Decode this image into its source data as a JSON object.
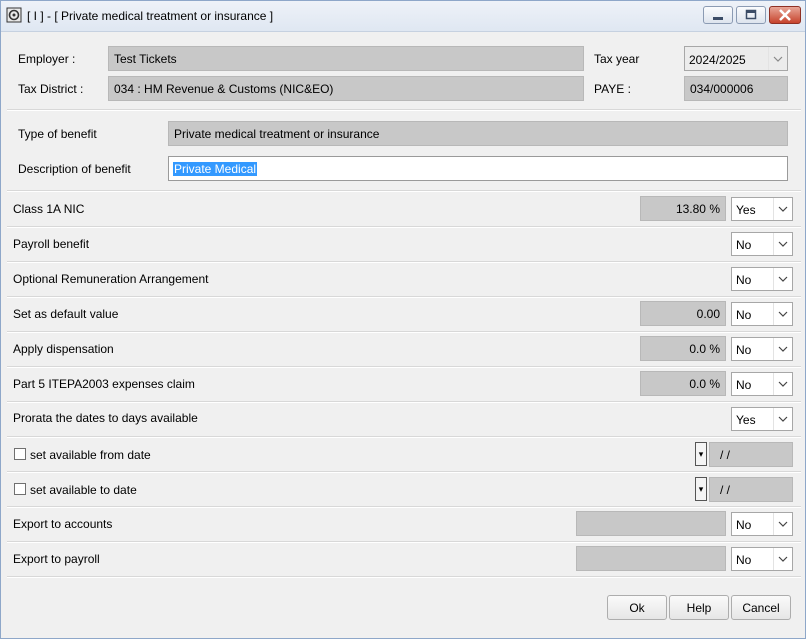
{
  "window": {
    "title": "[ I ] - [ Private medical treatment or insurance ]"
  },
  "header": {
    "employer_label": "Employer :",
    "employer_value": "Test Tickets",
    "tax_district_label": "Tax District :",
    "tax_district_value": "034 : HM Revenue & Customs (NIC&EO)",
    "tax_year_label": "Tax year",
    "tax_year_value": "2024/2025",
    "paye_label": "PAYE :",
    "paye_value": "034/000006"
  },
  "benefit": {
    "type_label": "Type of benefit",
    "type_value": "Private medical treatment or insurance",
    "desc_label": "Description of benefit",
    "desc_value": "Private Medical"
  },
  "rows": {
    "class1a": {
      "label": "Class 1A NIC",
      "value": "13.80 %",
      "select": "Yes"
    },
    "payroll": {
      "label": "Payroll benefit",
      "select": "No"
    },
    "ora": {
      "label": "Optional Remuneration Arrangement",
      "select": "No"
    },
    "default_value": {
      "label": "Set as default value",
      "value": "0.00",
      "select": "No"
    },
    "dispensation": {
      "label": "Apply dispensation",
      "value": "0.0 %",
      "select": "No"
    },
    "part5": {
      "label": "Part 5 ITEPA2003 expenses claim",
      "value": "0.0 %",
      "select": "No"
    },
    "prorata": {
      "label": "Prorata the dates to days available",
      "select": "Yes"
    },
    "avail_from": {
      "label": "set available from date",
      "date": " /  /"
    },
    "avail_to": {
      "label": "set available to date",
      "date": " /  /"
    },
    "export_accounts": {
      "label": "Export to accounts",
      "value": "",
      "select": "No"
    },
    "export_payroll": {
      "label": "Export to payroll",
      "value": "",
      "select": "No"
    }
  },
  "buttons": {
    "ok": "Ok",
    "help": "Help",
    "cancel": "Cancel"
  },
  "icons": {
    "window": "app-icon",
    "minimize": "minimize-icon",
    "maximize": "maximize-icon",
    "close": "close-icon",
    "dropdown": "chevron-down-icon"
  }
}
